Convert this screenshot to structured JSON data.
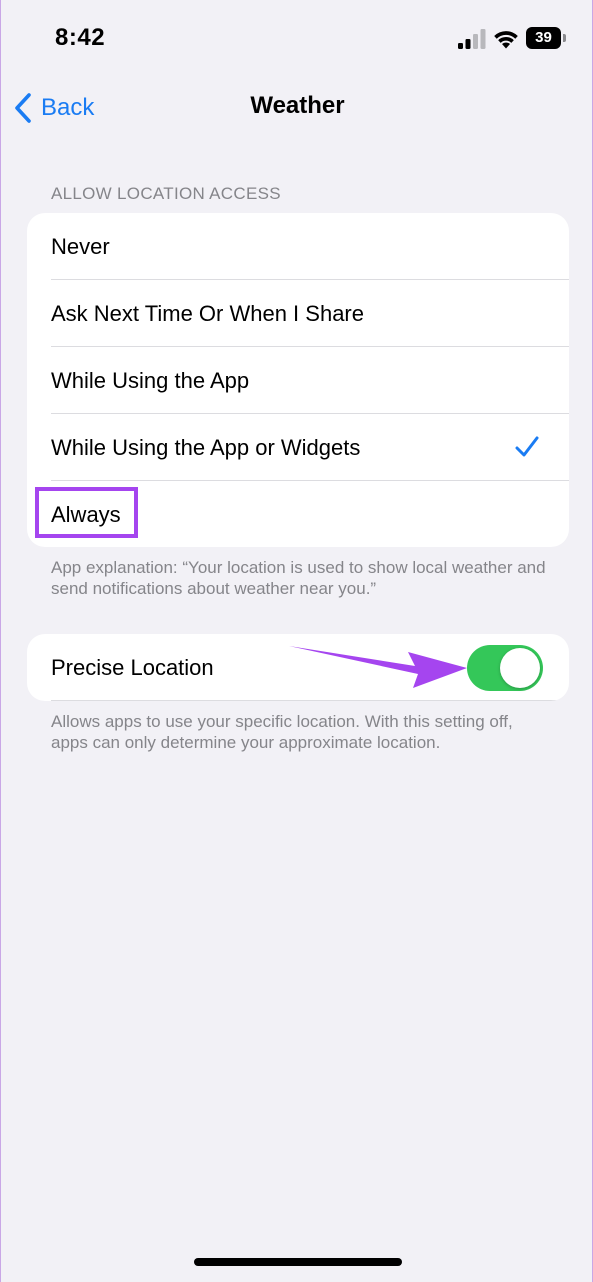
{
  "status_bar": {
    "time": "8:42",
    "battery": "39"
  },
  "nav": {
    "back_label": "Back",
    "title": "Weather"
  },
  "location_access": {
    "header": "ALLOW LOCATION ACCESS",
    "options": [
      {
        "label": "Never",
        "selected": false
      },
      {
        "label": "Ask Next Time Or When I Share",
        "selected": false
      },
      {
        "label": "While Using the App",
        "selected": false
      },
      {
        "label": "While Using the App or Widgets",
        "selected": true
      },
      {
        "label": "Always",
        "selected": false
      }
    ],
    "explanation": "App explanation: “Your location is used to show local weather and send notifications about weather near you.”"
  },
  "precise_location": {
    "label": "Precise Location",
    "enabled": true,
    "footer": "Allows apps to use your specific location. With this setting off, apps can only determine your approximate location."
  },
  "colors": {
    "accent": "#1a7cf3",
    "toggle_on": "#34c759",
    "annotation": "#a545ef",
    "background": "#f2f1f6"
  }
}
